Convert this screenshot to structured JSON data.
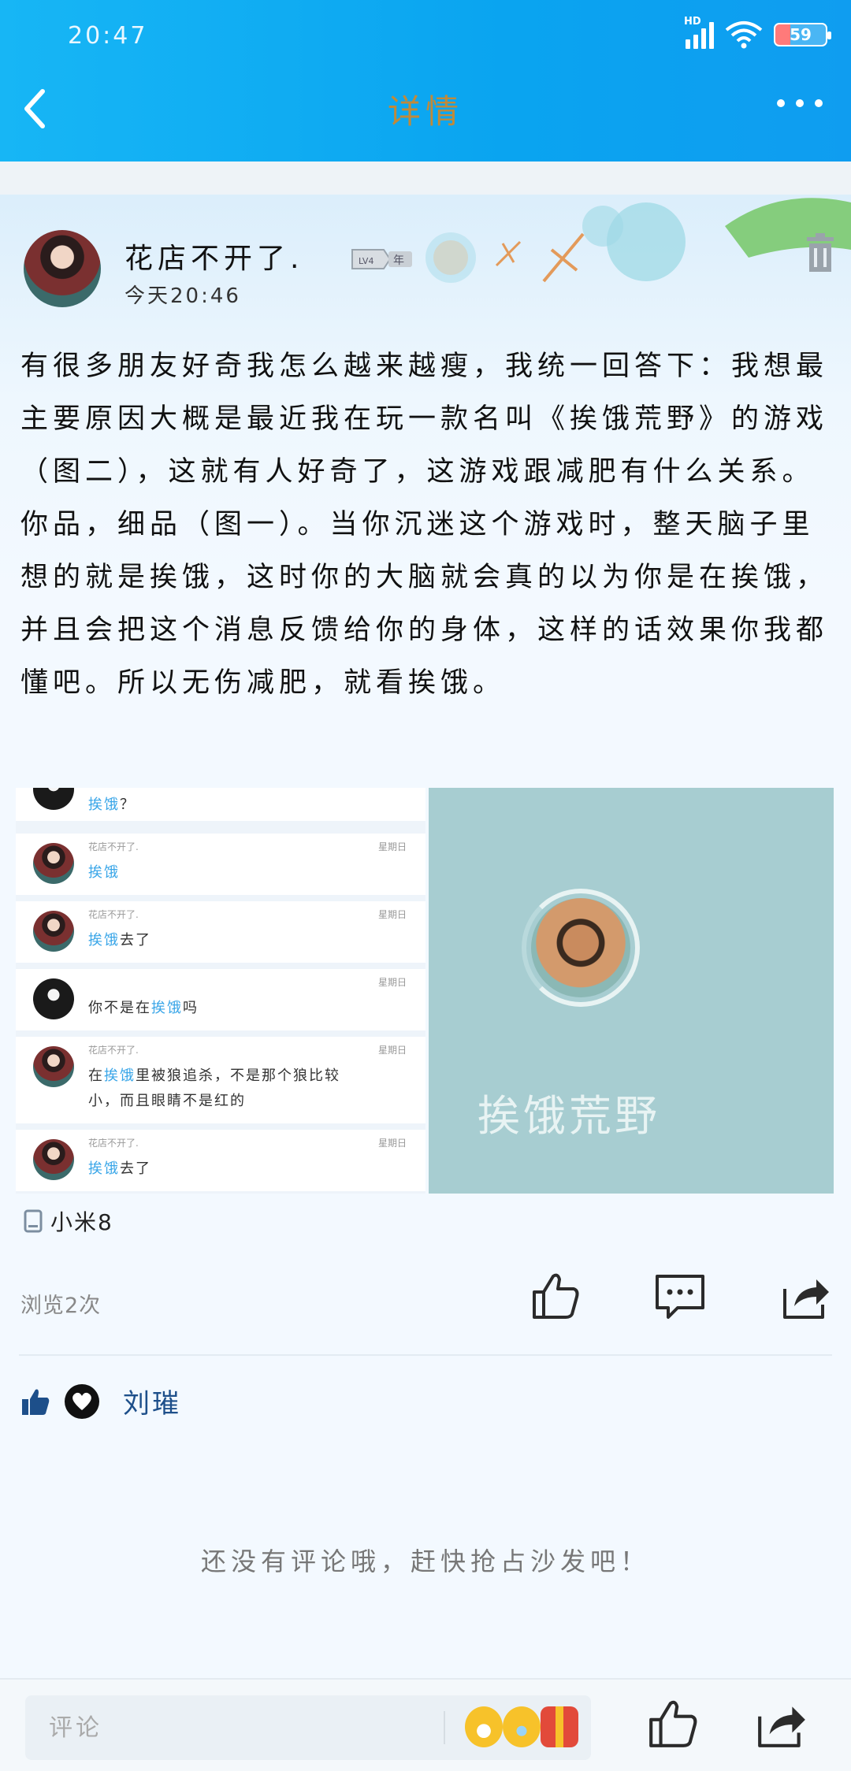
{
  "status": {
    "time": "20:47",
    "network": "HD",
    "battery": "59"
  },
  "header": {
    "title": "详情"
  },
  "post": {
    "author": "花店不开了.",
    "level": "LV4",
    "level_suffix": "年",
    "time": "今天20:46",
    "body": "有很多朋友好奇我怎么越来越瘦，我统一回答下：我想最主要原因大概是最近我在玩一款名叫《挨饿荒野》的游戏（图二），这就有人好奇了，这游戏跟减肥有什么关系。你品，细品（图一）。当你沉迷这个游戏时，整天脑子里想的就是挨饿，这时你的大脑就会真的以为你是在挨饿，并且会把这个消息反馈给你的身体，这样的话效果你我都懂吧。所以无伤减肥，就看挨饿。",
    "chat_image": {
      "rows": [
        {
          "meta": "",
          "date": "",
          "prefix": "",
          "highlight": "挨饿",
          "suffix": "？"
        },
        {
          "meta": "花店不开了.",
          "date": "星期日",
          "prefix": "",
          "highlight": "挨饿",
          "suffix": ""
        },
        {
          "meta": "花店不开了.",
          "date": "星期日",
          "prefix": "",
          "highlight": "挨饿",
          "suffix": "去了"
        },
        {
          "meta": "",
          "date": "星期日",
          "prefix": "你不是在",
          "highlight": "挨饿",
          "suffix": "吗"
        },
        {
          "meta": "花店不开了.",
          "date": "星期日",
          "prefix": "在",
          "highlight": "挨饿",
          "suffix": "里被狼追杀，不是那个狼比较",
          "line2": "小，而且眼睛不是红的"
        },
        {
          "meta": "花店不开了.",
          "date": "星期日",
          "prefix": "",
          "highlight": "挨饿",
          "suffix": "去了"
        }
      ]
    },
    "game_image": {
      "title": "挨饿荒野"
    },
    "device": "小米8",
    "views": "浏览2次",
    "liked_by": "刘璀",
    "no_comment": "还没有评论哦，赶快抢占沙发吧！"
  },
  "bottom_bar": {
    "comment_placeholder": "评论"
  },
  "colors": {
    "header": "#0aa4f0",
    "accent_link": "#3aa6e8",
    "title_text": "#c08a3a"
  }
}
